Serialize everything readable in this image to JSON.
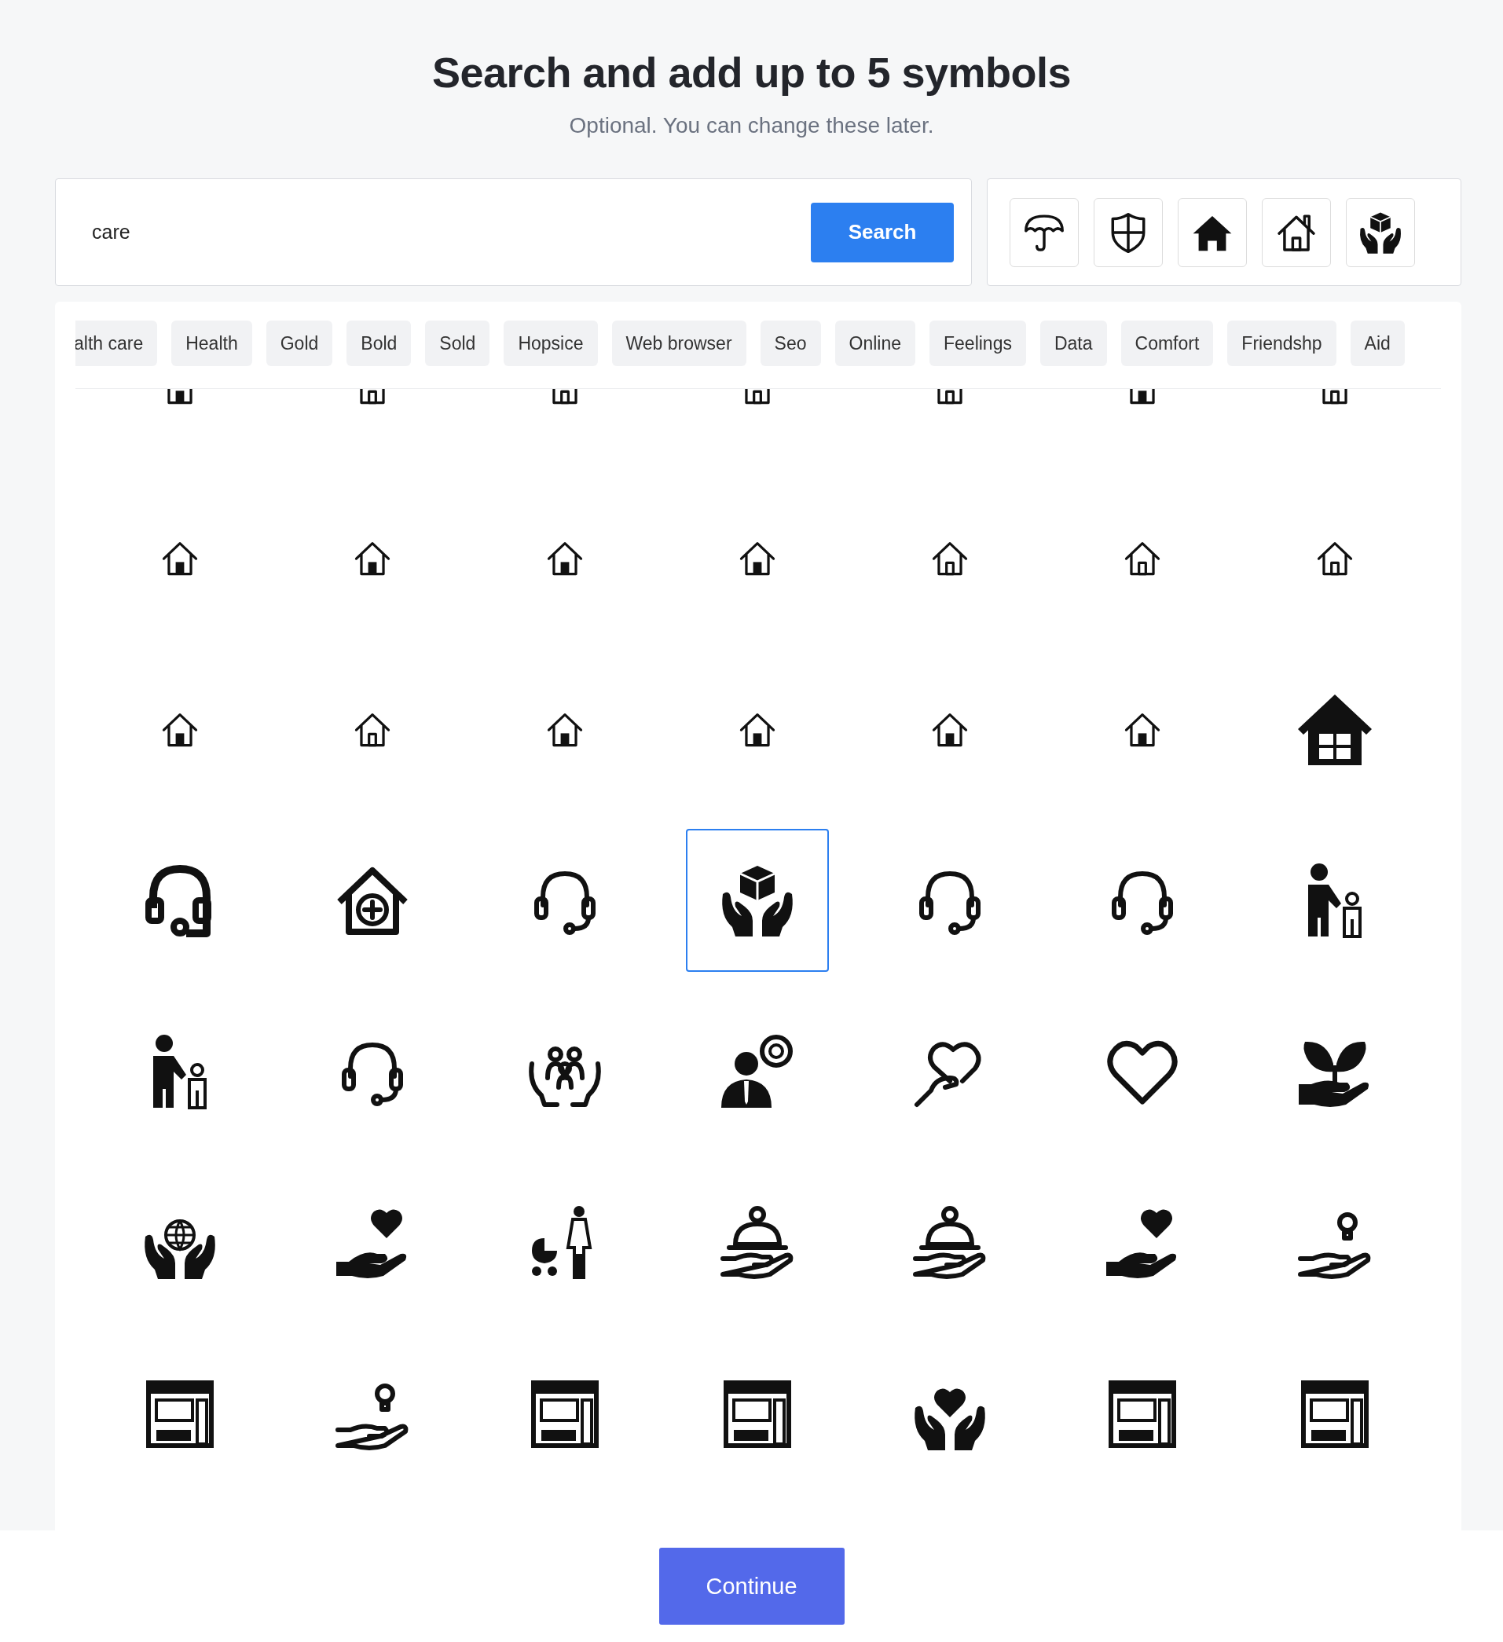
{
  "header": {
    "title": "Search and add up to 5 symbols",
    "subtitle": "Optional. You can change these later."
  },
  "search": {
    "value": "care",
    "button": "Search"
  },
  "selected_symbols": [
    {
      "kind": "umbrella"
    },
    {
      "kind": "shield"
    },
    {
      "kind": "house-filled"
    },
    {
      "kind": "house-chimney"
    },
    {
      "kind": "box-hands"
    }
  ],
  "results": {
    "tags": [
      "alth care",
      "Health",
      "Gold",
      "Bold",
      "Sold",
      "Hopsice",
      "Web browser",
      "Seo",
      "Online",
      "Feelings",
      "Data",
      "Comfort",
      "Friendshp",
      "Aid"
    ],
    "symbols": [
      {
        "kind": "house-door",
        "selected": false
      },
      {
        "kind": "house-outline",
        "selected": false
      },
      {
        "kind": "house-outline",
        "selected": false
      },
      {
        "kind": "house-outline",
        "selected": false
      },
      {
        "kind": "house-outline",
        "selected": false
      },
      {
        "kind": "house-door",
        "selected": false
      },
      {
        "kind": "house-outline",
        "selected": false
      },
      {
        "kind": "house-door",
        "selected": false
      },
      {
        "kind": "house-door",
        "selected": false
      },
      {
        "kind": "house-door",
        "selected": false
      },
      {
        "kind": "house-door",
        "selected": false
      },
      {
        "kind": "house-outline",
        "selected": false
      },
      {
        "kind": "house-outline",
        "selected": false
      },
      {
        "kind": "house-outline",
        "selected": false
      },
      {
        "kind": "house-door",
        "selected": false
      },
      {
        "kind": "house-outline",
        "selected": false
      },
      {
        "kind": "house-door",
        "selected": false
      },
      {
        "kind": "house-door",
        "selected": false
      },
      {
        "kind": "house-door",
        "selected": false
      },
      {
        "kind": "house-door",
        "selected": false
      },
      {
        "kind": "house-window",
        "selected": false
      },
      {
        "kind": "headset-bold",
        "selected": false
      },
      {
        "kind": "house-medical",
        "selected": false
      },
      {
        "kind": "headset",
        "selected": false
      },
      {
        "kind": "box-hands",
        "selected": true
      },
      {
        "kind": "headset",
        "selected": false
      },
      {
        "kind": "headset",
        "selected": false
      },
      {
        "kind": "person-child",
        "selected": false
      },
      {
        "kind": "person-child",
        "selected": false
      },
      {
        "kind": "headset",
        "selected": false
      },
      {
        "kind": "hands-people",
        "selected": false
      },
      {
        "kind": "businessman",
        "selected": false
      },
      {
        "kind": "heart-hand",
        "selected": false
      },
      {
        "kind": "heart",
        "selected": false
      },
      {
        "kind": "plant-hand",
        "selected": false
      },
      {
        "kind": "globe-hands",
        "selected": false
      },
      {
        "kind": "hand-heart",
        "selected": false
      },
      {
        "kind": "stroller-woman",
        "selected": false
      },
      {
        "kind": "service-hand",
        "selected": false
      },
      {
        "kind": "service-hand",
        "selected": false
      },
      {
        "kind": "hand-heart",
        "selected": false
      },
      {
        "kind": "hand-bulb",
        "selected": false
      },
      {
        "kind": "store",
        "selected": false
      },
      {
        "kind": "hand-bulb",
        "selected": false
      },
      {
        "kind": "store",
        "selected": false
      },
      {
        "kind": "store",
        "selected": false
      },
      {
        "kind": "heart-hands",
        "selected": false
      },
      {
        "kind": "store",
        "selected": false
      },
      {
        "kind": "store",
        "selected": false
      }
    ]
  },
  "footer": {
    "button": "Continue"
  }
}
